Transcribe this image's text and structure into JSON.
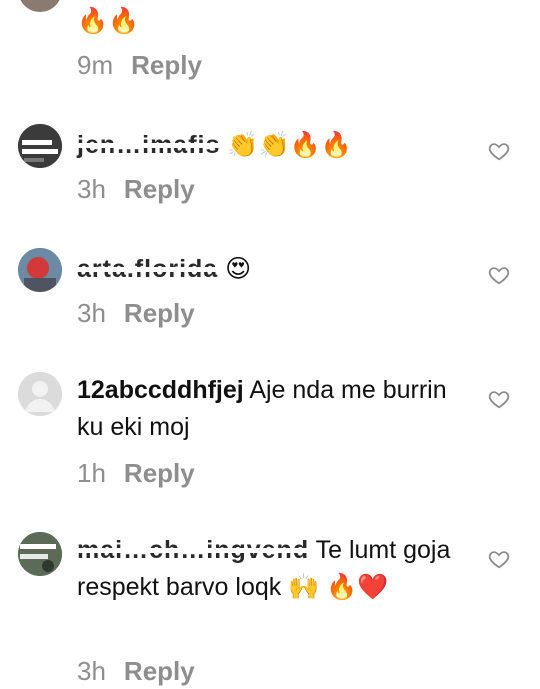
{
  "comments": [
    {
      "username": "",
      "text": "🔥🔥",
      "time": "9m",
      "reply_label": "Reply"
    },
    {
      "username": "jen…imafis",
      "text": "👏👏🔥🔥",
      "time": "3h",
      "reply_label": "Reply"
    },
    {
      "username": "arta.florida",
      "text": "😍",
      "time": "3h",
      "reply_label": "Reply"
    },
    {
      "username": "12abccddhfjej",
      "text": "Aje  nda  me burrin ku eki moj",
      "time": "1h",
      "reply_label": "Reply"
    },
    {
      "username": "mai…ch…ingvend",
      "text": "Te lumt goja respekt barvo loqk 🙌 🔥❤️",
      "time": "3h",
      "reply_label": "Reply"
    }
  ],
  "icons": {
    "like": "heart-outline-icon",
    "avatar_placeholder": "user-placeholder-icon"
  },
  "colors": {
    "meta": "#8e8e8e",
    "text": "#111111"
  }
}
